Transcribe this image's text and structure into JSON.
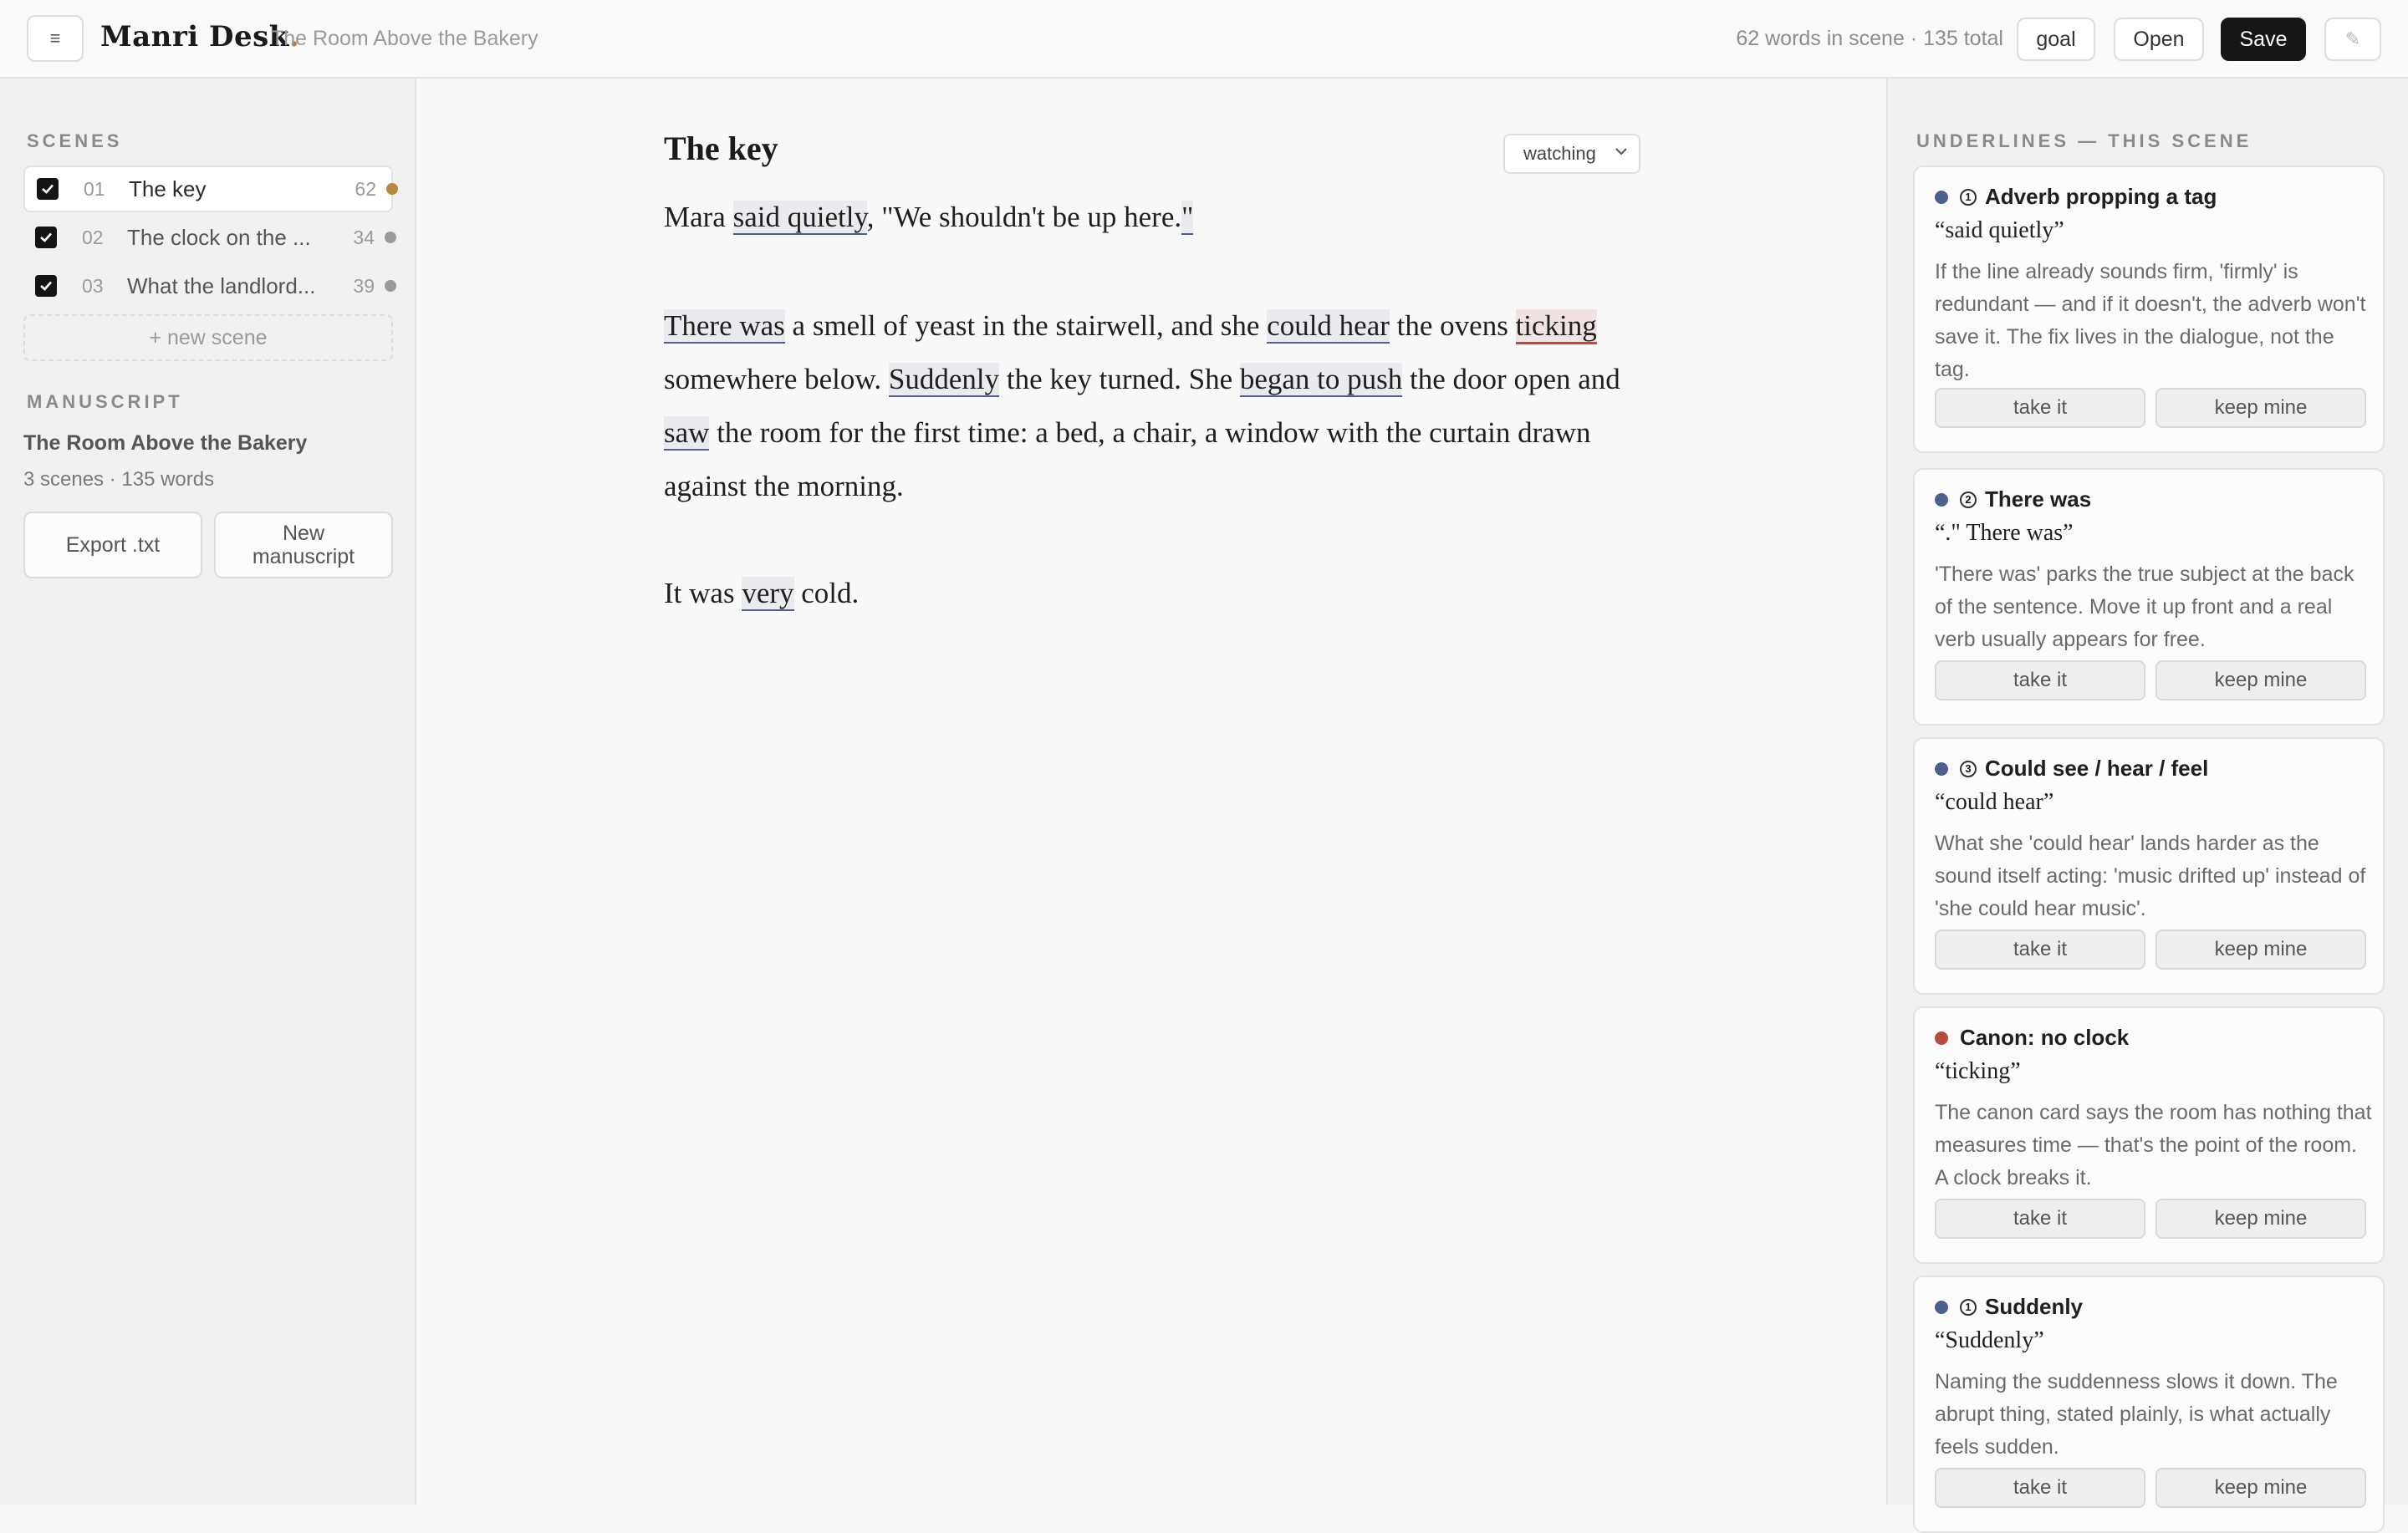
{
  "header": {
    "brand": "Manri Desk",
    "brand_dot": ".",
    "doc_title": "The Room Above the Bakery",
    "word_count": "62 words in scene · 135 total",
    "goal_label": "goal",
    "open_label": "Open",
    "save_label": "Save",
    "menu_glyph": "≡",
    "pencil_glyph": "✎"
  },
  "sidebar": {
    "scenes_label": "SCENES",
    "scenes": [
      {
        "num": "01",
        "name": "The key",
        "count": "62",
        "dot_color": "#b8873f"
      },
      {
        "num": "02",
        "name": "The clock on the ...",
        "count": "34",
        "dot_color": "#9a9a9a"
      },
      {
        "num": "03",
        "name": "What the landlord...",
        "count": "39",
        "dot_color": "#9a9a9a"
      }
    ],
    "new_scene_label": "+ new scene",
    "manuscript_label": "MANUSCRIPT",
    "manuscript_title": "The Room Above the Bakery",
    "manuscript_meta": "3 scenes · 135 words",
    "export_label": "Export .txt",
    "new_manuscript_label": "New manuscript"
  },
  "editor": {
    "scene_title": "The key",
    "mode": "watching",
    "paragraphs": [
      [
        {
          "t": "Mara "
        },
        {
          "t": "said quietly",
          "h": "blue"
        },
        {
          "t": ", \"We shouldn't be up here."
        },
        {
          "t": "\"",
          "h": "blue"
        }
      ],
      [
        {
          "t": "There was",
          "h": "blue"
        },
        {
          "t": " a smell of yeast in the stairwell, and she "
        },
        {
          "t": "could hear",
          "h": "blue"
        },
        {
          "t": " the ovens "
        },
        {
          "t": "ticking",
          "h": "red"
        },
        {
          "t": " somewhere below. "
        },
        {
          "t": "Suddenly",
          "h": "blue"
        },
        {
          "t": " the key turned. She "
        },
        {
          "t": "began to push",
          "h": "blue"
        },
        {
          "t": " the door open and "
        },
        {
          "t": "saw",
          "h": "blue"
        },
        {
          "t": " the room for the first time: a bed, a chair, a window with the curtain drawn against the morning."
        }
      ],
      [
        {
          "t": "It was "
        },
        {
          "t": "very",
          "h": "blue"
        },
        {
          "t": " cold."
        }
      ]
    ]
  },
  "underlines": {
    "label": "UNDERLINES — THIS SCENE",
    "take_label": "take it",
    "keep_label": "keep mine",
    "cards": [
      {
        "dot_color": "#4d5f8c",
        "icon": "1",
        "title": "Adverb propping a tag",
        "quote": "“said quietly”",
        "body": "If the line already sounds firm, 'firmly' is redundant — and if it doesn't, the adverb won't save it. The fix lives in the dialogue, not the tag."
      },
      {
        "dot_color": "#4d5f8c",
        "icon": "2",
        "title": "There was",
        "quote": "“.\" There was”",
        "body": "'There was' parks the true subject at the back of the sentence. Move it up front and a real verb usually appears for free."
      },
      {
        "dot_color": "#4d5f8c",
        "icon": "3",
        "title": "Could see / hear / feel",
        "quote": "“could hear”",
        "body": "What she 'could hear' lands harder as the sound itself acting: 'music drifted up' instead of 'she could hear music'."
      },
      {
        "dot_color": "#b64a40",
        "icon": "",
        "title": "Canon: no clock",
        "quote": "“ticking”",
        "body": "The canon card says the room has nothing that measures time — that's the point of the room. A clock breaks it."
      },
      {
        "dot_color": "#4d5f8c",
        "icon": "1",
        "title": "Suddenly",
        "quote": "“Suddenly”",
        "body": "Naming the suddenness slows it down. The abrupt thing, stated plainly, is what actually feels sudden."
      }
    ]
  }
}
